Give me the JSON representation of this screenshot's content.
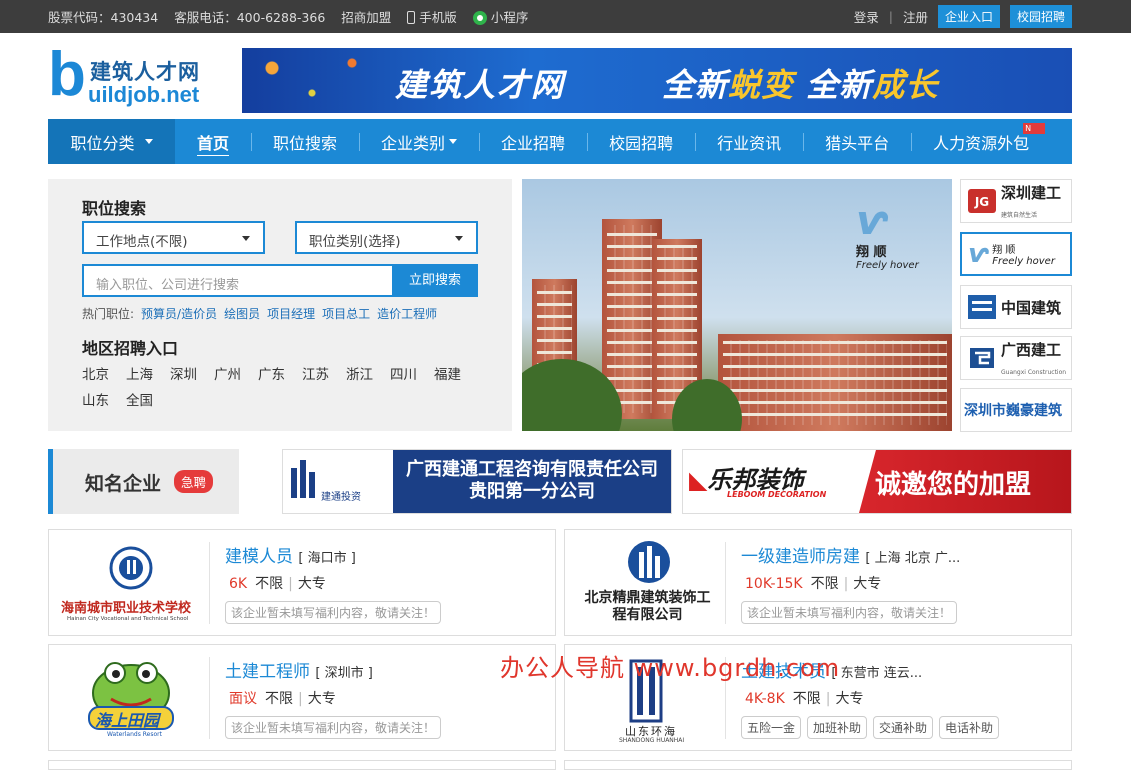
{
  "topbar": {
    "stock": "股票代码：430434",
    "hotline": "客服电话：400-6288-366",
    "join": "招商加盟",
    "mobile": "手机版",
    "mini": "小程序",
    "login": "登录",
    "register": "注册",
    "company_entry": "企业入口",
    "campus": "校园招聘"
  },
  "logo": {
    "cn": "建筑人才网",
    "b": "b",
    "en": "uildjob.net"
  },
  "banner": {
    "left": "建筑人才网",
    "new1": "全新",
    "change": "蜕变",
    "new2": "全新",
    "grow": "成长"
  },
  "nav": {
    "category": "职位分类",
    "items": [
      "首页",
      "职位搜索",
      "企业类别",
      "企业招聘",
      "校园招聘",
      "行业资讯",
      "猎头平台",
      "人力资源外包"
    ]
  },
  "search": {
    "title": "职位搜索",
    "location": "工作地点(不限)",
    "jobtype": "职位类别(选择)",
    "placeholder": "输入职位、公司进行搜索",
    "button": "立即搜索",
    "hot_label": "热门职位:",
    "hot": [
      "预算员/造价员",
      "绘图员",
      "项目经理",
      "项目总工",
      "造价工程师"
    ],
    "region_title": "地区招聘入口",
    "cities": [
      "北京",
      "上海",
      "深圳",
      "广州",
      "广东",
      "江苏",
      "浙江",
      "四川",
      "福建",
      "山东",
      "全国"
    ]
  },
  "photo_logo": {
    "cn": "翔 顺",
    "en": "Freely hover"
  },
  "brands": [
    "深圳建工",
    "翔 顺",
    "中国建筑",
    "广西建工",
    "深圳市巍豪建筑"
  ],
  "brand_subs": {
    "xiangshun": "Freely hover",
    "sz_sub": "建筑自然生活",
    "gx_sub": "Guangxi Construction"
  },
  "famous": {
    "title": "知名企业",
    "badge": "急聘"
  },
  "ad1": {
    "logo_text": "建通投资",
    "line1": "广西建通工程咨询有限责任公司",
    "line2": "贵阳第一分公司"
  },
  "ad2": {
    "brand": "乐邦装饰",
    "brand_en": "LEBOOM DECORATION",
    "slogan": "诚邀您的加盟"
  },
  "jobs": [
    {
      "company_logo": "海南城市职业技术学校",
      "company_en": "Hainan City Vocational and Technical School",
      "title": "建模人员",
      "location": "[ 海口市 ]",
      "salary": "6K",
      "exp": "不限",
      "edu": "大专",
      "tags": [
        "该企业暂未填写福利内容，敬请关注！"
      ]
    },
    {
      "company_logo": "北京精鼎建筑装饰工程有限公司",
      "title": "一级建造师房建",
      "location": "[ 上海 北京 广...",
      "salary": "10K-15K",
      "exp": "不限",
      "edu": "大专",
      "tags": [
        "该企业暂未填写福利内容，敬请关注！"
      ]
    },
    {
      "company_logo": "海上田园",
      "company_en": "Waterlands Resort",
      "title": "土建工程师",
      "location": "[ 深圳市 ]",
      "salary": "面议",
      "exp": "不限",
      "edu": "大专",
      "tags": [
        "该企业暂未填写福利内容，敬请关注！"
      ]
    },
    {
      "company_logo": "山东环海",
      "company_en": "SHANDONG HUANHAI",
      "title": "土建技术员",
      "location": "[ 东营市 连云...",
      "salary": "4K-8K",
      "exp": "不限",
      "edu": "大专",
      "tags": [
        "五险一金",
        "加班补助",
        "交通补助",
        "电话补助"
      ]
    }
  ],
  "watermark": "办公人导航 www.bgrdh.com",
  "colors": {
    "accent": "#1c89d5",
    "salary": "#e03a2b",
    "topbar": "#3d3d3d"
  }
}
